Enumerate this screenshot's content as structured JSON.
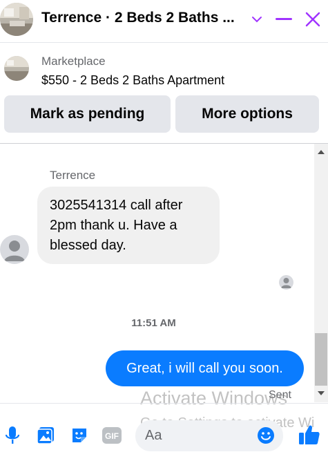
{
  "header": {
    "title": "Terrence · 2 Beds 2 Baths ...",
    "accent_color": "#a033ff",
    "icons": [
      "chevron-down-icon",
      "minimize-icon",
      "close-icon"
    ]
  },
  "listing": {
    "label": "Marketplace",
    "item": "$550 - 2 Beds 2 Baths Apartment",
    "buttons": {
      "pending": "Mark as pending",
      "options": "More options"
    }
  },
  "conversation": {
    "sender_name": "Terrence",
    "incoming": "3025541314 call after 2pm thank u. Have a blessed day.",
    "timestamp": "11:51 AM",
    "outgoing": "Great, i will call you soon.",
    "status": "Sent",
    "outgoing_color": "#0a7cff"
  },
  "watermark": {
    "line1": "Activate Windows",
    "line2": "Go to Settings to activate Wi"
  },
  "composer": {
    "placeholder": "Aa",
    "icon_color": "#0a7cff",
    "tools": [
      "microphone-icon",
      "photo-icon",
      "sticker-icon",
      "gif-icon",
      "emoji-icon",
      "thumbs-up-icon"
    ],
    "gif_label": "GIF"
  }
}
